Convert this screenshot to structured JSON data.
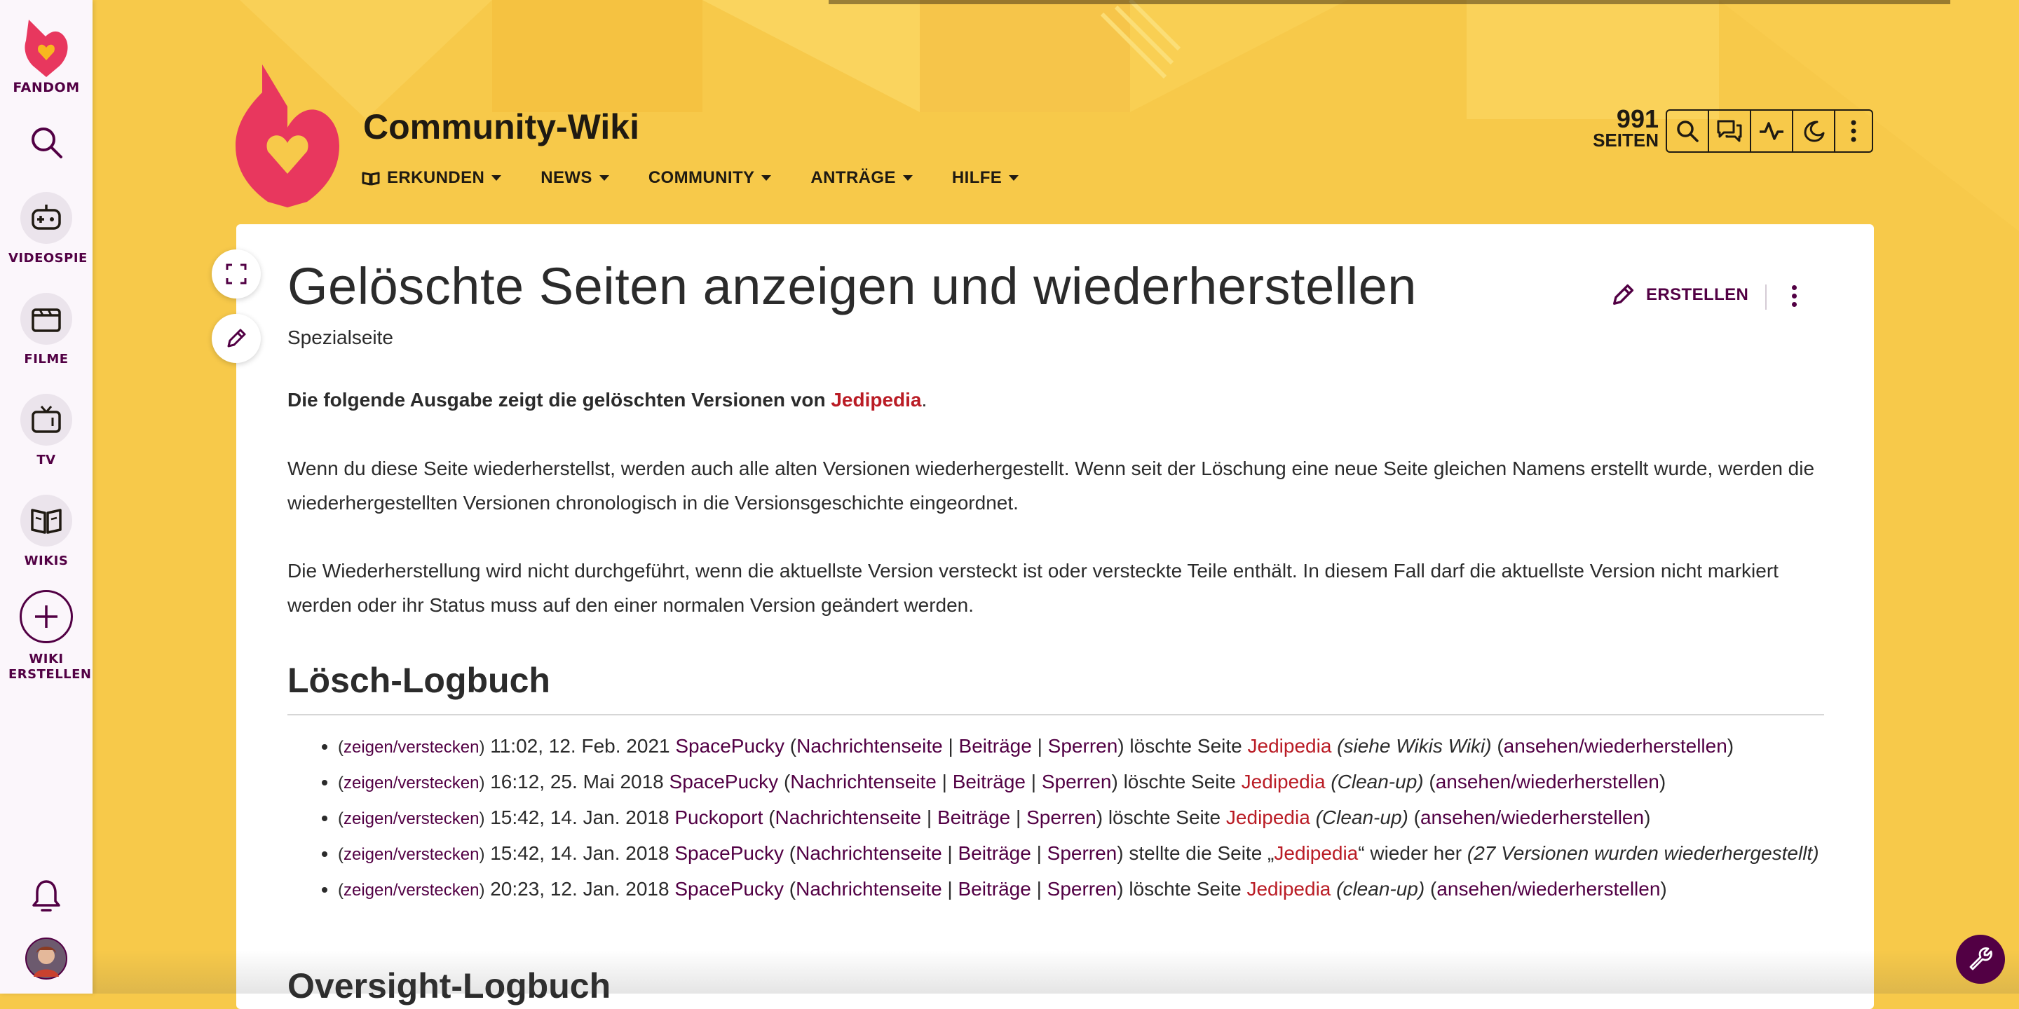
{
  "rail": {
    "brand_label": "FANDOM",
    "items": [
      {
        "label": "VIDEOSPIE"
      },
      {
        "label": "FILME"
      },
      {
        "label": "TV"
      },
      {
        "label": "WIKIS"
      },
      {
        "label_line1": "WIKI",
        "label_line2": "ERSTELLEN"
      }
    ]
  },
  "header": {
    "wiki_title": "Community-Wiki",
    "nav": [
      {
        "label": "ERKUNDEN"
      },
      {
        "label": "NEWS"
      },
      {
        "label": "COMMUNITY"
      },
      {
        "label": "ANTRÄGE"
      },
      {
        "label": "HILFE"
      }
    ],
    "page_count": "991",
    "page_count_label": "SEITEN"
  },
  "article": {
    "title": "Gelöschte Seiten anzeigen und wiederherstellen",
    "subtitle": "Spezialseite",
    "create_label": "ERSTELLEN",
    "intro_bold": "Die folgende Ausgabe zeigt die gelöschten Versionen von ",
    "intro_link": "Jedipedia",
    "intro_end": ".",
    "para1": "Wenn du diese Seite wiederherstellst, werden auch alle alten Versionen wiederhergestellt. Wenn seit der Löschung eine neue Seite gleichen Namens erstellt wurde, werden die wiederhergestellten Versionen chronologisch in die Versionsgeschichte eingeordnet.",
    "para2": "Die Wiederherstellung wird nicht durchgeführt, wenn die aktuellste Version versteckt ist oder versteckte Teile enthält. In diesem Fall darf die aktuellste Version nicht markiert werden oder ihr Status muss auf den einer normalen Version geändert werden.",
    "log_heading": "Lösch-Logbuch",
    "oversight_heading": "Oversight-Logbuch"
  },
  "log": {
    "toggle_label": "zeigen/verstecken",
    "talk_label": "Nachrichtenseite",
    "contribs_label": "Beiträge",
    "block_label": "Sperren",
    "view_restore_label": "ansehen/wiederherstellen",
    "entries": [
      {
        "time": "11:02, 12. Feb. 2021",
        "user": "SpacePucky",
        "action": "löschte Seite",
        "page": "Jedipedia",
        "comment": "(siehe Wikis Wiki)"
      },
      {
        "time": "16:12, 25. Mai 2018",
        "user": "SpacePucky",
        "action": "löschte Seite",
        "page": "Jedipedia",
        "comment": "(Clean-up)"
      },
      {
        "time": "15:42, 14. Jan. 2018",
        "user": "Puckoport",
        "action": "löschte Seite",
        "page": "Jedipedia",
        "comment": "(Clean-up)"
      },
      {
        "time": "15:42, 14. Jan. 2018",
        "user": "SpacePucky",
        "action": "stellte die Seite „",
        "page": "Jedipedia",
        "action_end": "“ wieder her",
        "comment": "(27 Versionen wurden wiederhergestellt)"
      },
      {
        "time": "20:23, 12. Jan. 2018",
        "user": "SpacePucky",
        "action": "löschte Seite",
        "page": "Jedipedia",
        "comment": "(clean-up)"
      }
    ]
  },
  "colors": {
    "background": "#f7c94a",
    "brand_pink": "#e8375e",
    "dark_link": "#520044",
    "red_link": "#ba1c25"
  },
  "icons": [
    "fandom-logo",
    "search-icon",
    "gamepad-icon",
    "film-icon",
    "tv-icon",
    "book-icon",
    "plus-icon",
    "bell-icon",
    "avatar",
    "wiki-logo",
    "discussion-icon",
    "activity-icon",
    "moon-icon",
    "more-vertical-icon",
    "expand-icon",
    "pencil-icon",
    "wrench-icon"
  ]
}
